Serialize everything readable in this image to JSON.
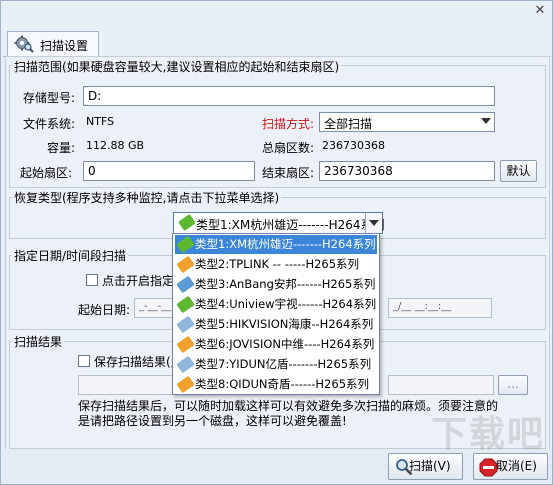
{
  "window": {
    "close_glyph": "✕"
  },
  "tab": {
    "label": "扫描设置",
    "icon": "gear-search-icon"
  },
  "scan_range": {
    "title": "扫描范围(如果硬盘容量较大,建议设置相应的起始和结束扇区)",
    "storage_label": "存储型号:",
    "storage_value": "D:",
    "fs_label": "文件系统:",
    "fs_value": "NTFS",
    "capacity_label": "容量:",
    "capacity_value": "112.88 GB",
    "scan_mode_label": "扫描方式:",
    "scan_mode_value": "全部扫描",
    "total_sectors_label": "总扇区数:",
    "total_sectors_value": "236730368",
    "start_sector_label": "起始扇区:",
    "start_sector_value": "0",
    "end_sector_label": "结束扇区:",
    "end_sector_value": "236730368",
    "default_button": "默认"
  },
  "recovery_type": {
    "title": "恢复类型(程序支持多种监控,请点击下拉菜单选择)",
    "selected": "类型1:XM杭州雄迈-------H264系列",
    "options": [
      {
        "label": "类型1:XM杭州雄迈-------H264系列",
        "color": "#5cb82e"
      },
      {
        "label": "类型2:TPLINK        -- -----H265系列",
        "color": "#f0a32c"
      },
      {
        "label": "类型3:AnBang安邦------H265系列",
        "color": "#5b9bd8"
      },
      {
        "label": "类型4:Uniview宇视------H264系列",
        "color": "#5cb82e"
      },
      {
        "label": "类型5:HIKVISION海康--H264系列",
        "color": "#8fb6dc"
      },
      {
        "label": "类型6:JOVISION中维----H264系列",
        "color": "#f0a32c"
      },
      {
        "label": "类型7:YIDUN亿盾-------H265系列",
        "color": "#8fb6dc"
      },
      {
        "label": "类型8:QIDUN奇盾------H265系列",
        "color": "#f0a32c"
      }
    ]
  },
  "date_range": {
    "title": "指定日期/时间段扫描",
    "enable_label": "点击开启指定日",
    "start_date_label": "起始日期:",
    "start_date_value": "_-__-__ __:__:__",
    "end_date_value": "_/__ __:__:__"
  },
  "scan_result": {
    "title": "扫描结果",
    "save_label": "保存扫描结果(点",
    "path_value": "",
    "browse_button": "...",
    "note": "保存扫描结果后，可以随时加载这样可以有效避免多次扫描的麻烦。须要注意的是请把路径设置到另一个磁盘，这样可以避免覆盖!"
  },
  "footer": {
    "scan_button": "扫描(V)",
    "cancel_button": "取消(E)"
  },
  "watermark": "下载吧"
}
